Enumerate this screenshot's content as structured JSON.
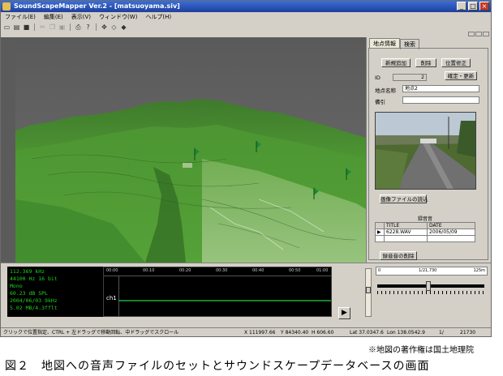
{
  "window": {
    "title": "SoundScapeMapper Ver.2 - [matsuoyama.siv]"
  },
  "menu": [
    "ファイル(E)",
    "編集(E)",
    "表示(V)",
    "ウィンドウ(W)",
    "ヘルプ(H)"
  ],
  "tabs": {
    "active": "地点情報",
    "other": "検索"
  },
  "panel": {
    "new_point": "新規追加",
    "delete": "削除",
    "fix_position": "位置修正",
    "id_label": "ID",
    "id_value": "2",
    "confirm_update": "確定・更新",
    "point_name_label": "地点名称",
    "point_name_value": "地点2",
    "memo_label": "備引",
    "load_image": "画像ファイルの読込",
    "sound_list_title": "録音音",
    "sound_list_headers": [
      "TITLE",
      "DATE"
    ],
    "sound_list_rows": [
      {
        "marker": "▶",
        "title": "6228.WAV",
        "date": "2006/05/09"
      }
    ],
    "sound_delete": "録音音の削除"
  },
  "wave_info": [
    "112.369 kHz",
    "44100 Hz 16 bit",
    "Mono",
    "60.23 dB SPL",
    "2004/06/03 9kHz",
    "5.02 MB/4.3fflt"
  ],
  "wave_channel_label": "ch1",
  "wave_ticks": [
    "00:00",
    "00:10",
    "00:20",
    "00:30",
    "00:40",
    "00:50",
    "01:00"
  ],
  "scale": {
    "left": "0",
    "middle": "1/21,730",
    "right": "125m"
  },
  "status": {
    "hint": "クリックで位置指定、CTRL + 左ドラッグで移動回転、中ドラッグでスクロール",
    "x": "X 111997.66",
    "y": "Y 84340.40",
    "h": "H 606.60",
    "lat": "Lat 37.0347.6",
    "lon": "Lon 138.0542.9",
    "page": "1/",
    "scale": "21730"
  },
  "copyright_note": "※地図の著作権は国土地理院",
  "figure_caption": "図２　地図への音声ファイルのセットとサウンドスケープデータベースの画面",
  "icons": [
    "app-icon",
    "minimize-icon",
    "maximize-icon",
    "close-icon",
    "new-file-icon",
    "open-icon",
    "save-icon",
    "cut-icon",
    "copy-icon",
    "paste-icon",
    "print-icon",
    "help-icon",
    "move-icon",
    "zoom-icon",
    "rotate-icon",
    "play-icon"
  ],
  "colors": {
    "title_bar": "#1f3f9c",
    "wave_text": "#21d020",
    "marker_green": "#1b8a36"
  }
}
